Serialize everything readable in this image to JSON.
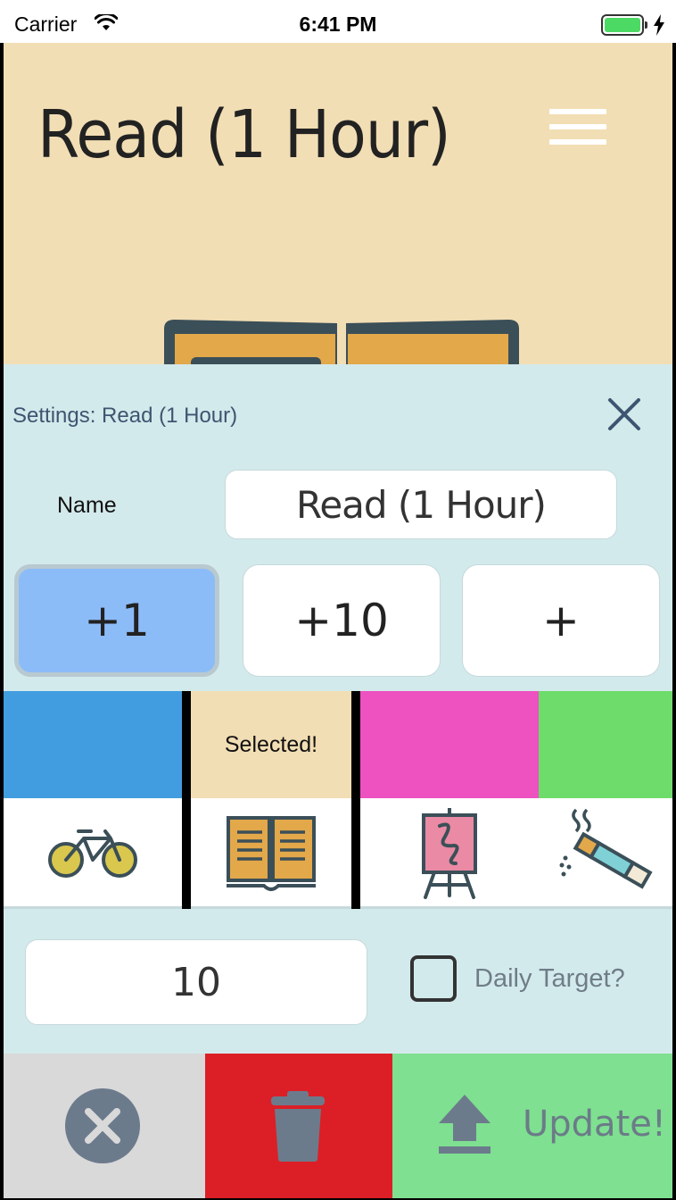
{
  "status_bar": {
    "carrier": "Carrier",
    "time": "6:41 PM",
    "wifi_icon": "wifi-icon",
    "battery_icon": "battery-icon",
    "charging_icon": "bolt-icon"
  },
  "header": {
    "title": "Read (1 Hour)",
    "menu_icon": "hamburger-menu-icon",
    "illustration_icon": "open-book-icon",
    "background_color": "#f2deb4"
  },
  "settings": {
    "title": "Settings: Read (1 Hour)",
    "close_icon": "close-icon",
    "name_label": "Name",
    "name_value": "Read (1 Hour)",
    "increment_buttons": [
      {
        "label": "+1",
        "selected": true
      },
      {
        "label": "+10",
        "selected": false
      },
      {
        "label": "+",
        "selected": false
      }
    ],
    "colors": [
      {
        "color": "#419ddf",
        "label": ""
      },
      {
        "color": "#f2deb4",
        "label": "Selected!"
      },
      {
        "color": "#ed52c0",
        "label": ""
      },
      {
        "color": "#6edc6a",
        "label": ""
      }
    ],
    "icons": [
      "bicycle-icon",
      "open-book-icon",
      "easel-painting-icon",
      "cigarette-icon"
    ],
    "target_value": "10",
    "daily_target_label": "Daily Target?",
    "daily_target_checked": false
  },
  "actions": {
    "cancel_icon": "cancel-circle-icon",
    "delete_icon": "trash-icon",
    "update_icon": "upload-arrow-icon",
    "update_label": "Update!",
    "colors": {
      "cancel": "#d9d9d9",
      "delete": "#dc1f26",
      "update": "#7ee090"
    }
  }
}
